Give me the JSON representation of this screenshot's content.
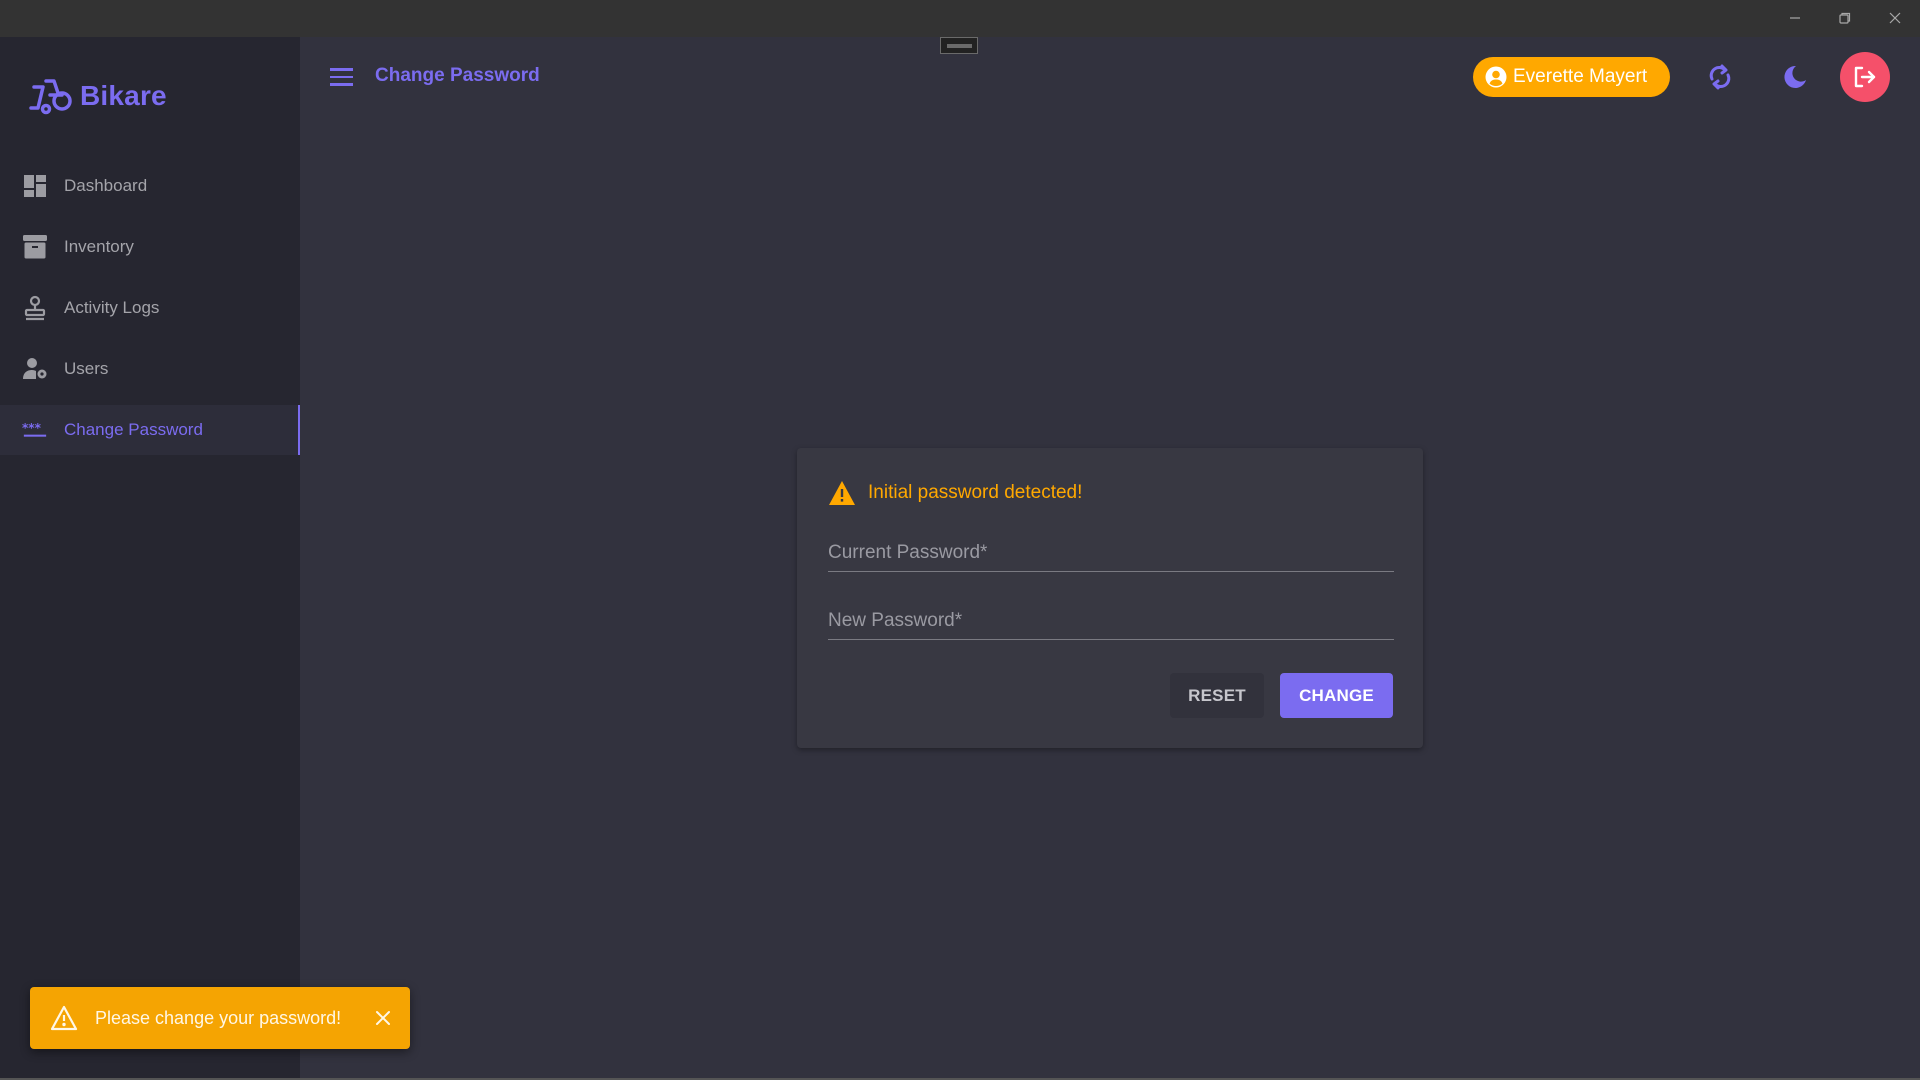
{
  "window": {
    "controls": [
      "minimize",
      "restore",
      "close"
    ]
  },
  "brand": {
    "name": "Bikare",
    "logo_icon": "wheelchair-cart-icon",
    "accent_color": "#7b6cf0"
  },
  "sidebar": {
    "items": [
      {
        "label": "Dashboard",
        "icon": "dashboard-icon",
        "active": false
      },
      {
        "label": "Inventory",
        "icon": "archive-box-icon",
        "active": false
      },
      {
        "label": "Activity Logs",
        "icon": "stamp-icon",
        "active": false
      },
      {
        "label": "Users",
        "icon": "user-gear-icon",
        "active": false
      },
      {
        "label": "Change Password",
        "icon": "password-icon",
        "active": true
      }
    ]
  },
  "header": {
    "title": "Change Password",
    "menu_icon": "hamburger-menu-icon",
    "user_name": "Everette Mayert",
    "user_chip_color": "#ffa800",
    "refresh_icon": "refresh-icon",
    "theme_icon": "moon-icon",
    "logout_icon": "logout-icon",
    "logout_color": "#f5506a"
  },
  "card": {
    "warning_text": "Initial password detected!",
    "warning_color": "#ffa800",
    "current_password": {
      "placeholder": "Current Password*",
      "value": ""
    },
    "new_password": {
      "placeholder": "New Password*",
      "value": ""
    },
    "reset_label": "RESET",
    "change_label": "CHANGE"
  },
  "toast": {
    "message": "Please change your password!",
    "icon": "warning-triangle-icon",
    "color": "#f5a402"
  }
}
